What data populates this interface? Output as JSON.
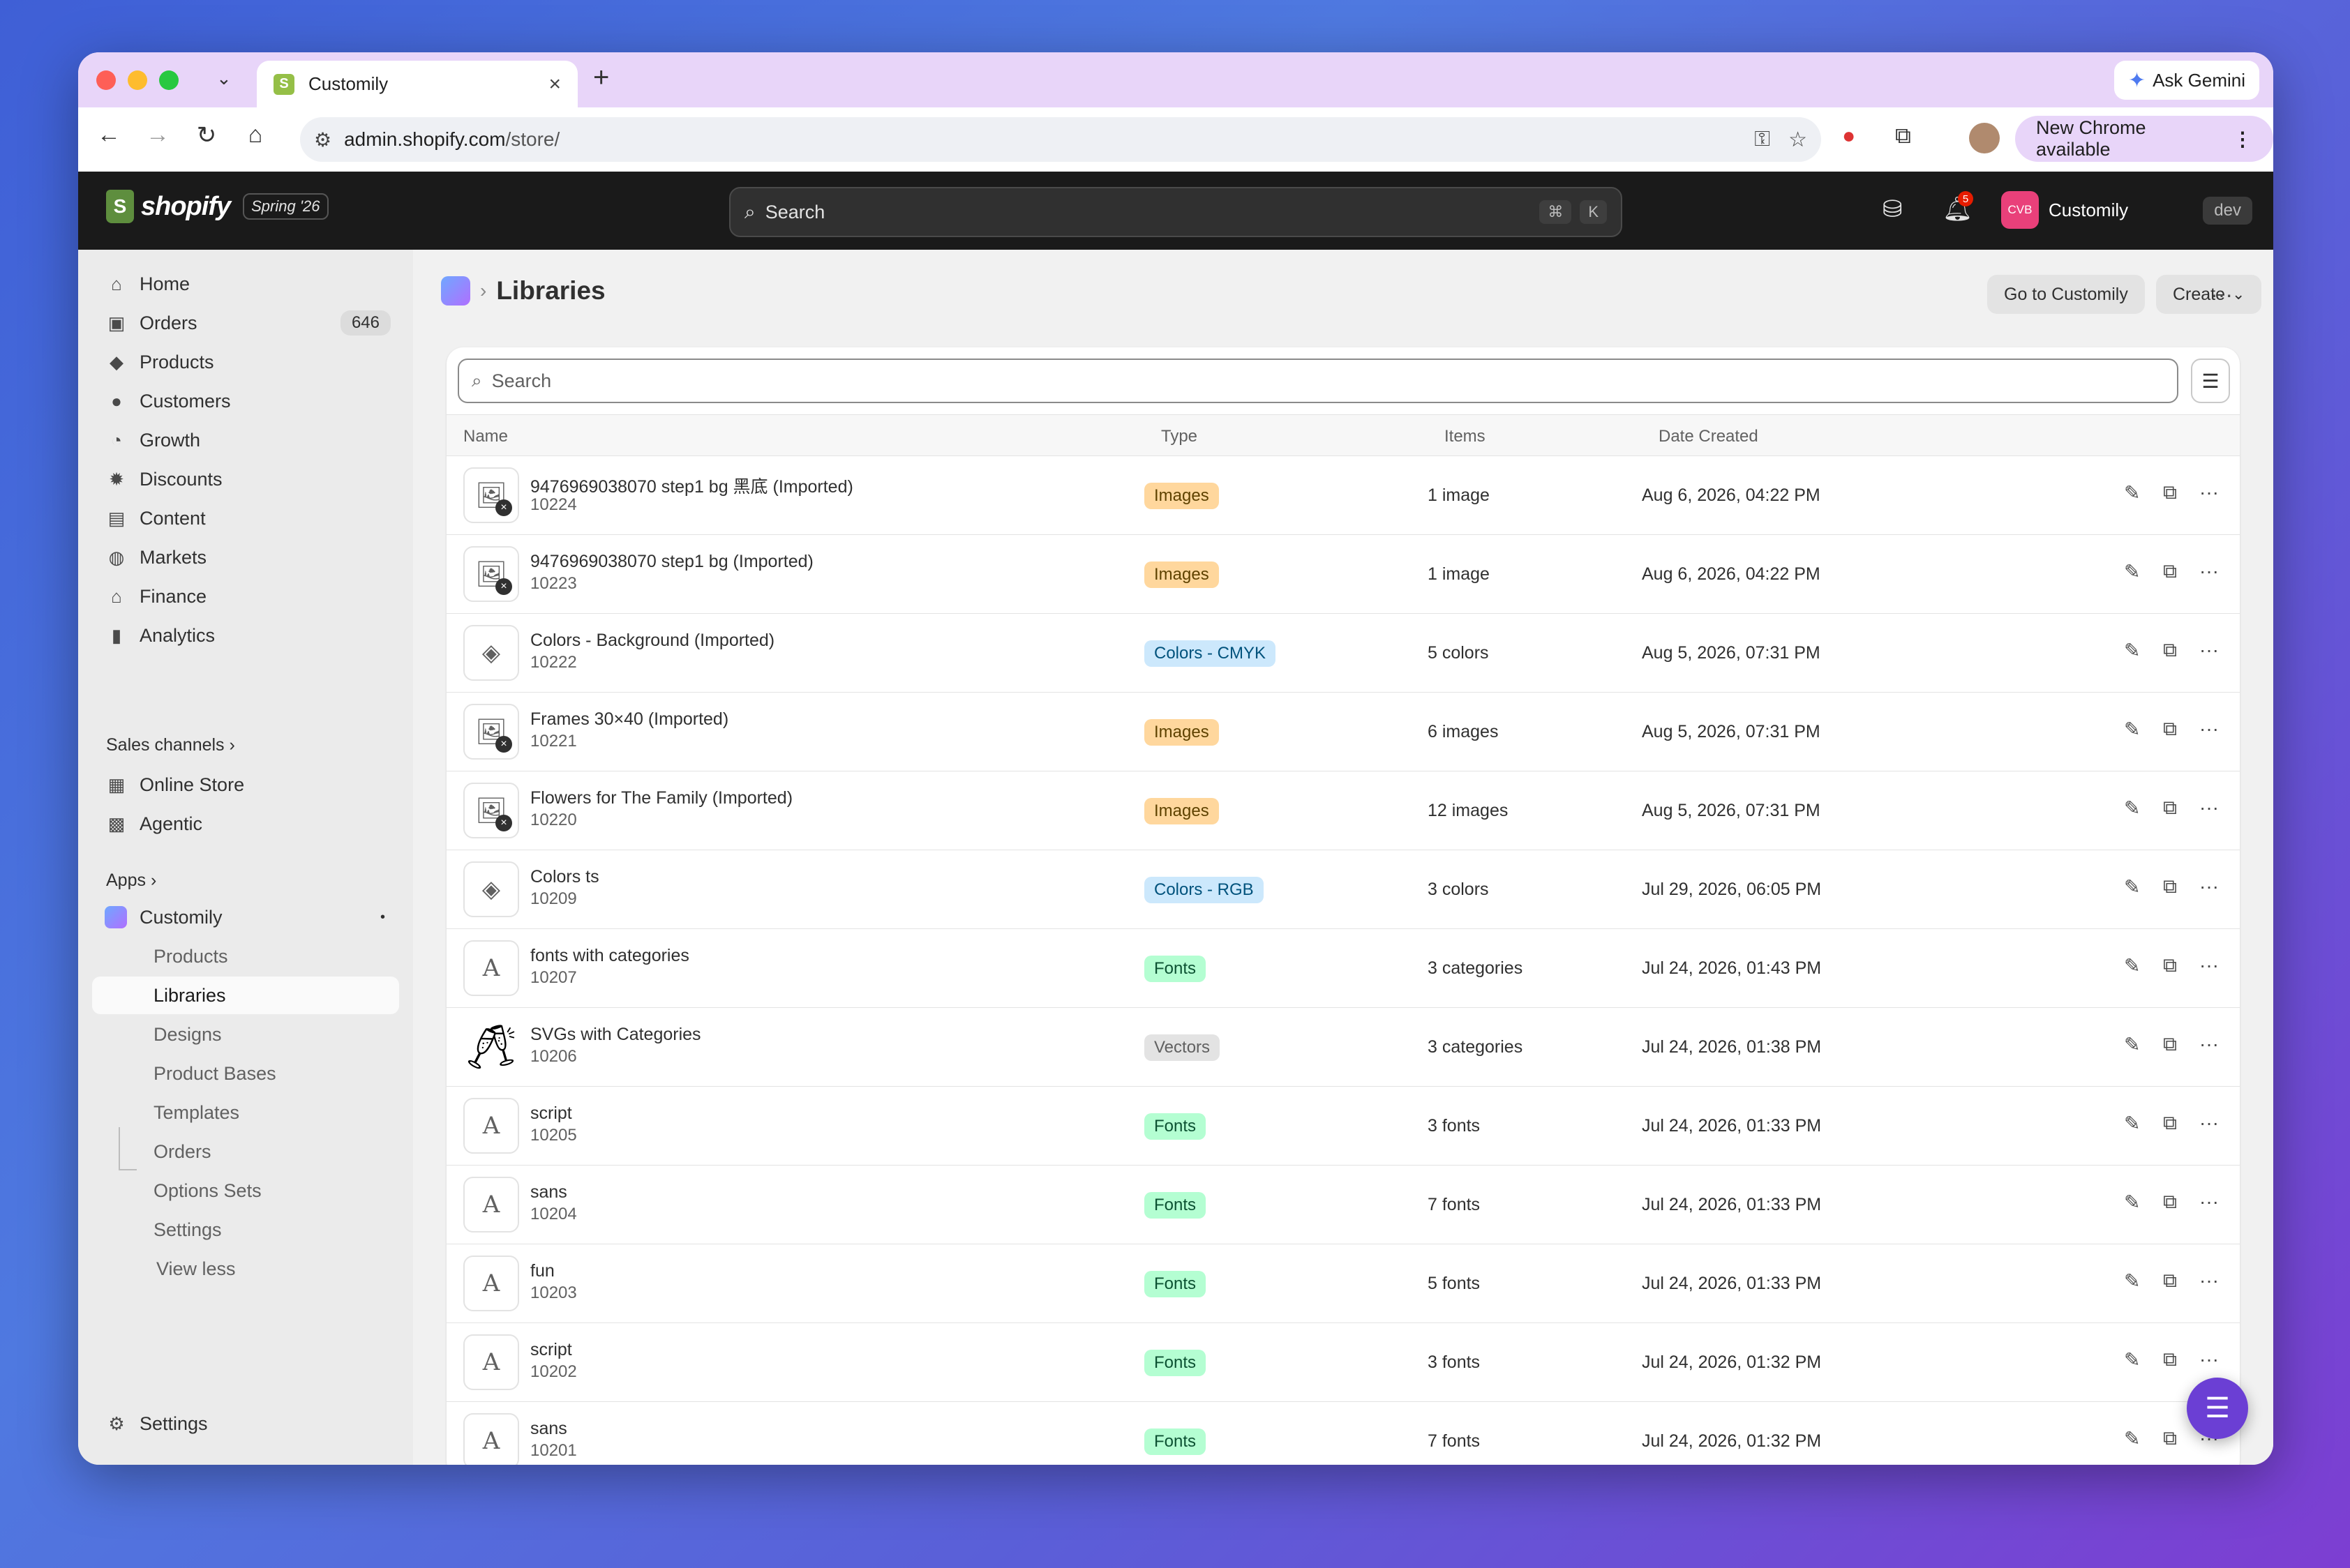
{
  "browser": {
    "tab_title": "Customily",
    "ask_gemini": "Ask Gemini",
    "url_host": "admin.shopify.com",
    "url_path": "/store/",
    "new_chrome": "New Chrome available"
  },
  "header": {
    "brand": "shopify",
    "edition": "Spring '26",
    "search_placeholder": "Search",
    "kbd_cmd": "⌘",
    "kbd_k": "K",
    "notif_count": "5",
    "store_initials": "CVB",
    "store_name": "Customily",
    "env_tag": "dev"
  },
  "sidebar": {
    "items": [
      {
        "label": "Home",
        "icon": "home-icon"
      },
      {
        "label": "Orders",
        "icon": "orders-icon",
        "count": "646"
      },
      {
        "label": "Products",
        "icon": "tag-icon"
      },
      {
        "label": "Customers",
        "icon": "person-icon"
      },
      {
        "label": "Growth",
        "icon": "growth-icon"
      },
      {
        "label": "Discounts",
        "icon": "discount-icon"
      },
      {
        "label": "Content",
        "icon": "content-icon"
      },
      {
        "label": "Markets",
        "icon": "globe-icon"
      },
      {
        "label": "Finance",
        "icon": "bank-icon"
      },
      {
        "label": "Analytics",
        "icon": "bar-chart-icon"
      }
    ],
    "sales_channels_label": "Sales channels",
    "channels": [
      {
        "label": "Online Store"
      },
      {
        "label": "Agentic"
      }
    ],
    "apps_label": "Apps",
    "app_name": "Customily",
    "app_subitems": [
      "Products",
      "Libraries",
      "Designs",
      "Product Bases",
      "Templates",
      "Orders",
      "Options Sets",
      "Settings",
      "View less"
    ],
    "settings_label": "Settings"
  },
  "page": {
    "title": "Libraries",
    "go_button": "Go to Customily",
    "create_button": "Create",
    "search_placeholder": "Search",
    "columns": {
      "name": "Name",
      "type": "Type",
      "items": "Items",
      "date": "Date Created"
    },
    "rows": [
      {
        "name": "9476969038070 step1 bg 黑底 (Imported)",
        "id": "10224",
        "type": "Images",
        "items": "1 image",
        "date": "Aug 6, 2026, 04:22 PM",
        "thumb": "image"
      },
      {
        "name": "9476969038070 step1 bg (Imported)",
        "id": "10223",
        "type": "Images",
        "items": "1 image",
        "date": "Aug 6, 2026, 04:22 PM",
        "thumb": "image"
      },
      {
        "name": "Colors - Background (Imported)",
        "id": "10222",
        "type": "Colors - CMYK",
        "items": "5 colors",
        "date": "Aug 5, 2026, 07:31 PM",
        "thumb": "color"
      },
      {
        "name": "Frames 30×40 (Imported)",
        "id": "10221",
        "type": "Images",
        "items": "6 images",
        "date": "Aug 5, 2026, 07:31 PM",
        "thumb": "image"
      },
      {
        "name": "Flowers for The Family (Imported)",
        "id": "10220",
        "type": "Images",
        "items": "12 images",
        "date": "Aug 5, 2026, 07:31 PM",
        "thumb": "image"
      },
      {
        "name": "Colors ts",
        "id": "10209",
        "type": "Colors - RGB",
        "items": "3 colors",
        "date": "Jul 29, 2026, 06:05 PM",
        "thumb": "color"
      },
      {
        "name": "fonts with categories",
        "id": "10207",
        "type": "Fonts",
        "items": "3 categories",
        "date": "Jul 24, 2026, 01:43 PM",
        "thumb": "font"
      },
      {
        "name": "SVGs with Categories",
        "id": "10206",
        "type": "Vectors",
        "items": "3 categories",
        "date": "Jul 24, 2026, 01:38 PM",
        "thumb": "vector"
      },
      {
        "name": "script",
        "id": "10205",
        "type": "Fonts",
        "items": "3 fonts",
        "date": "Jul 24, 2026, 01:33 PM",
        "thumb": "font"
      },
      {
        "name": "sans",
        "id": "10204",
        "type": "Fonts",
        "items": "7 fonts",
        "date": "Jul 24, 2026, 01:33 PM",
        "thumb": "font"
      },
      {
        "name": "fun",
        "id": "10203",
        "type": "Fonts",
        "items": "5 fonts",
        "date": "Jul 24, 2026, 01:33 PM",
        "thumb": "font"
      },
      {
        "name": "script",
        "id": "10202",
        "type": "Fonts",
        "items": "3 fonts",
        "date": "Jul 24, 2026, 01:32 PM",
        "thumb": "font"
      },
      {
        "name": "sans",
        "id": "10201",
        "type": "Fonts",
        "items": "7 fonts",
        "date": "Jul 24, 2026, 01:32 PM",
        "thumb": "font"
      }
    ]
  },
  "colors": {
    "tab_strip": "#e8d5f9",
    "header_bg": "#1a1a1a",
    "badge_images": "#ffd79d",
    "badge_colors": "#cce8fc",
    "badge_fonts": "#b4fed2",
    "badge_vectors": "#e3e3e3",
    "chat_button": "#6b3fd4"
  }
}
